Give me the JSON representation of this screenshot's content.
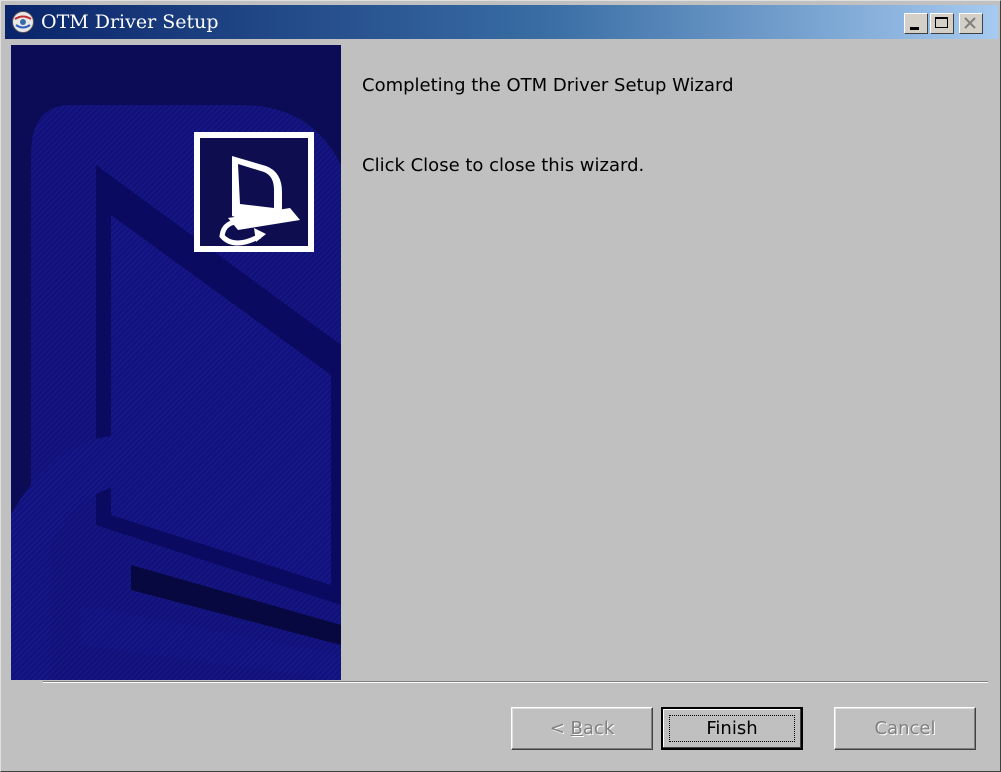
{
  "window": {
    "title": "OTM Driver Setup"
  },
  "titlebar_buttons": {
    "minimize_icon": "minimize-icon",
    "maximize_icon": "maximize-icon",
    "close_icon": "close-icon"
  },
  "wizard": {
    "heading": "Completing the OTM Driver Setup Wizard",
    "body": "Click Close to close this wizard."
  },
  "buttons": {
    "back_prefix": "< ",
    "back_mnemonic": "B",
    "back_rest": "ack",
    "finish": "Finish",
    "cancel": "Cancel"
  },
  "colors": {
    "titlebar_start": "#0a246a",
    "titlebar_end": "#a6caf0",
    "banner": "#0c0c56",
    "dialog_bg": "#c0c0c0"
  }
}
